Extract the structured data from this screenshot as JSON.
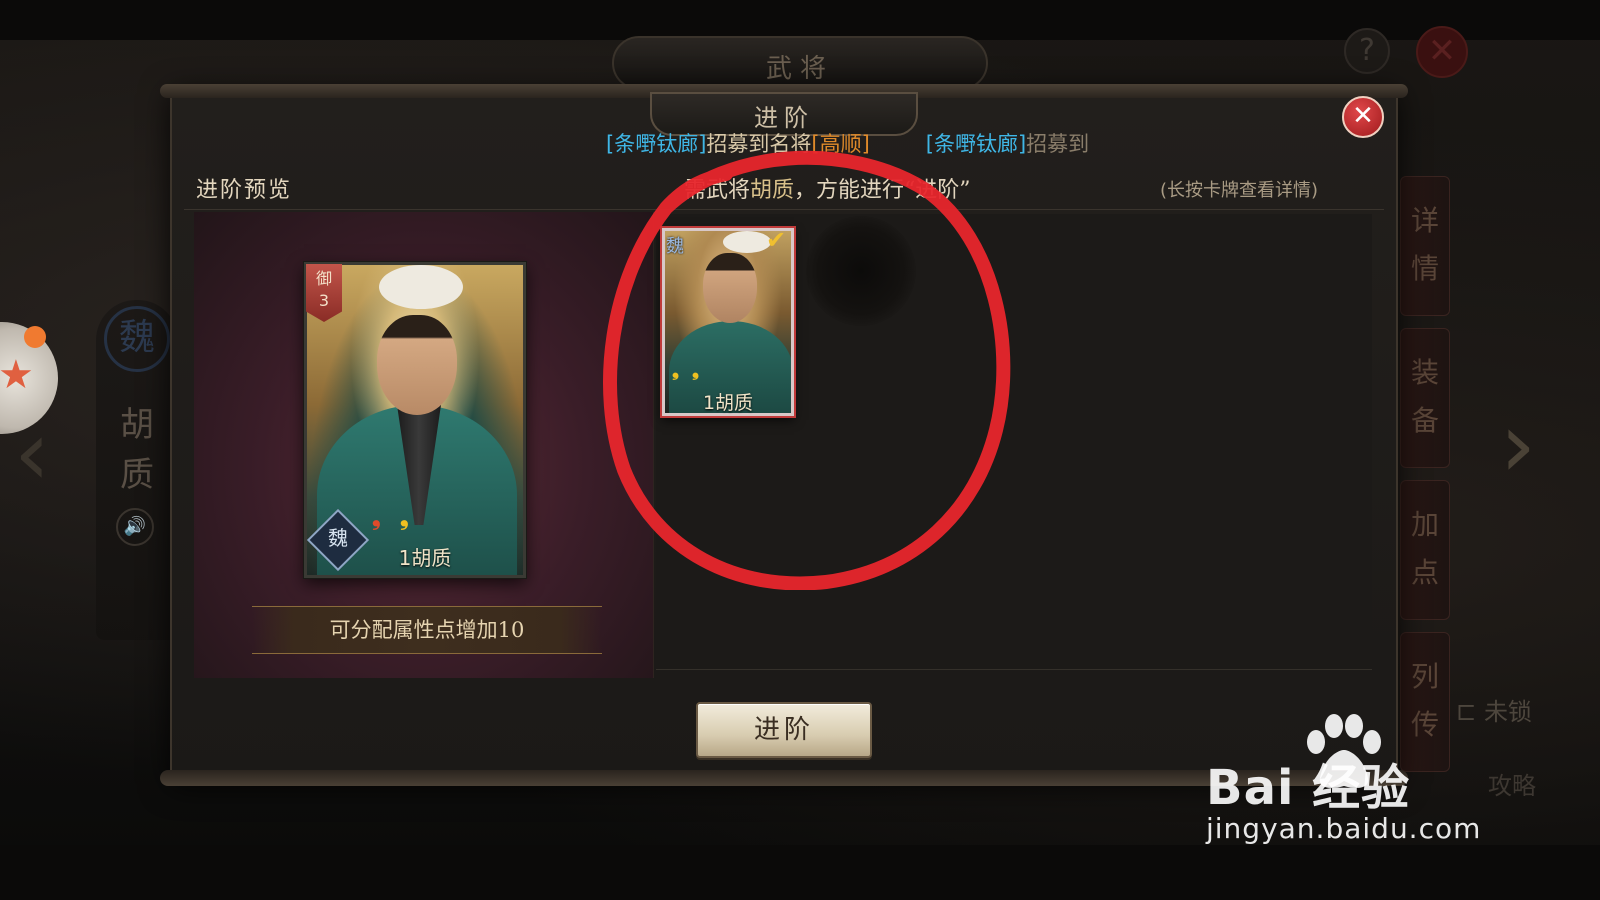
{
  "background": {
    "title": "武将",
    "help_glyph": "?",
    "close_glyph": "✕",
    "hero_faction": "魏",
    "hero_name": "胡质",
    "side_tabs": [
      "详情",
      "装备",
      "加点",
      "列传"
    ],
    "lock_label": "未锁",
    "guide_label": "攻略"
  },
  "dialog": {
    "title": "进阶",
    "close_glyph": "✕"
  },
  "ticker": {
    "msg1_player": "[条嘢钛廊]",
    "msg1_text": "招募到名将",
    "msg1_hero": "[高顺]",
    "msg2_player": "[条嘢钛廊]",
    "msg2_text": "招募到"
  },
  "header": {
    "preview_label": "进阶预览",
    "instruction_prefix": "需武将",
    "instruction_hero": "胡质",
    "instruction_suffix": "，方能进行“进阶”",
    "hint": "(长按卡牌查看详情)"
  },
  "preview": {
    "rank_type": "御",
    "rank_level": "3",
    "faction": "魏",
    "card_name": "1胡质",
    "bonus_text": "可分配属性点增加10"
  },
  "material": {
    "faction": "魏",
    "card_name": "1胡质",
    "selected": true
  },
  "actions": {
    "advance_label": "进阶"
  },
  "watermark": {
    "brand": "Bai  经验",
    "url": "jingyan.baidu.com"
  },
  "colors": {
    "annotation_red": "#e8262c",
    "player_name_cyan": "#3fb6e6",
    "hero_name_orange": "#e08a2a",
    "close_red": "#c0292b"
  }
}
